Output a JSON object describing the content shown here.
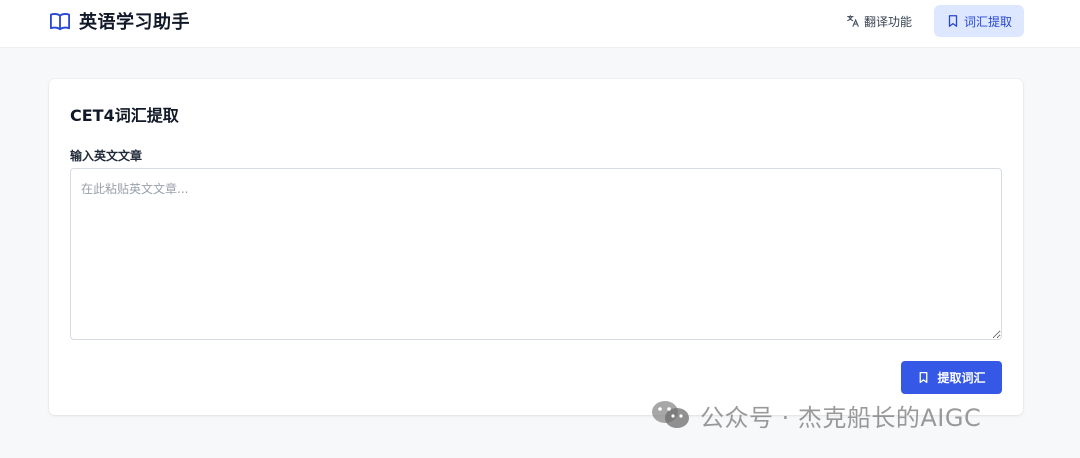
{
  "app": {
    "title": "英语学习助手",
    "brand_icon": "open-book-icon",
    "accent": "#3558e6"
  },
  "nav": {
    "items": [
      {
        "label": "翻译功能",
        "icon": "translate-icon",
        "active": false
      },
      {
        "label": "词汇提取",
        "icon": "bookmark-icon",
        "active": true
      }
    ]
  },
  "card": {
    "title": "CET4词汇提取",
    "input_label": "输入英文文章",
    "textarea": {
      "placeholder": "在此粘贴英文文章...",
      "value": ""
    },
    "submit_label": "提取词汇",
    "submit_icon": "bookmark-icon"
  },
  "watermark": {
    "text": "公众号 · 杰克船长的AIGC",
    "icon": "wechat-icon"
  }
}
